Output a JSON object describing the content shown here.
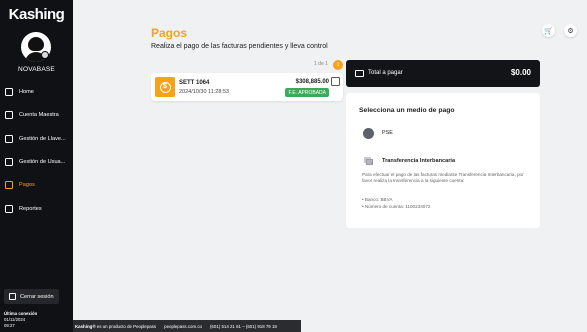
{
  "app": {
    "logo_text": "Kashing"
  },
  "sidebar": {
    "company_name": "NOVABASE",
    "items": [
      {
        "label": "Home",
        "icon": "home-icon",
        "active": false
      },
      {
        "label": "Cuenta Maestra",
        "icon": "wallet-icon",
        "active": false
      },
      {
        "label": "Gestión de Llave...",
        "icon": "key-icon",
        "active": false
      },
      {
        "label": "Gestión de Usua...",
        "icon": "users-icon",
        "active": false
      },
      {
        "label": "Pagos",
        "icon": "payments-icon",
        "active": true
      },
      {
        "label": "Reportes",
        "icon": "reports-icon",
        "active": false
      }
    ],
    "logout_label": "Cerrar sesión",
    "last_connection_label": "Última conexión",
    "last_connection_date": "01/11/2024",
    "last_connection_time": "09:27"
  },
  "footer": {
    "brand": "Kashing®",
    "product_text": "es un producto de Peoplepass",
    "website": "peoplepass.com.co",
    "phones": "(601) 514 21 61 – (601) 918 79 19"
  },
  "header": {
    "cart_icon": "cart-icon",
    "settings_icon": "settings-icon"
  },
  "main": {
    "title": "Pagos",
    "subtitle": "Realiza el pago de las facturas pendientes y lleva control",
    "pagination": {
      "text": "1 de 1",
      "current_page": "1"
    },
    "invoices": [
      {
        "name": "SETT 1064",
        "date": "2024/10/30 11:28:53",
        "amount": "$308,885.00",
        "status": "F.E. APROBADA"
      }
    ]
  },
  "total": {
    "label": "Total a pagar",
    "value": "$0.00"
  },
  "payment_methods": {
    "title": "Selecciona un medio de pago",
    "pse_label": "PSE",
    "transfer_label": "Transferencia Interbancaria",
    "transfer_description": "Para efectuar el pago de las facturas mediante Transferencia Interbancaria, por favor realiza la transferencia a la siguiente cuenta:",
    "bank_line": "• Banco: BBVA",
    "account_line": "• Número de cuenta: 1100234072"
  },
  "colors": {
    "accent": "#f7a21b",
    "sidebar_bg": "#0f1115",
    "approved": "#3daa5a"
  }
}
